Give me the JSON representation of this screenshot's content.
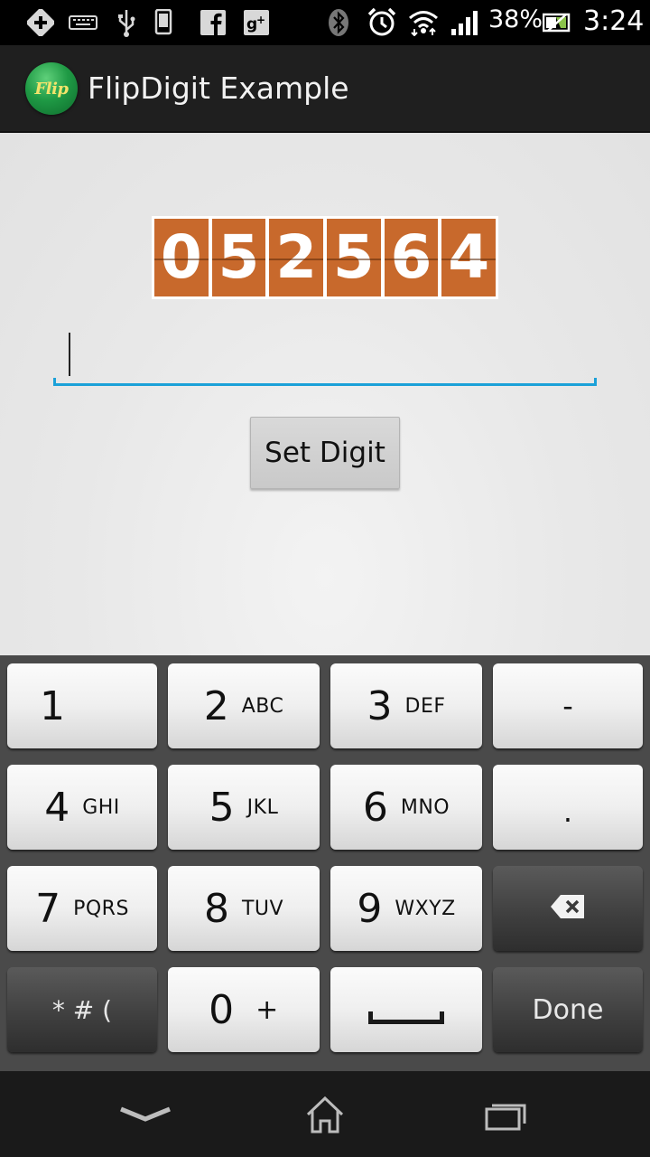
{
  "status_bar": {
    "battery_percent": "38%",
    "time": "3:24",
    "icons": [
      "add-icon",
      "keyboard-icon",
      "usb-icon",
      "phone-icon",
      "facebook-icon",
      "google-plus-icon",
      "bluetooth-icon",
      "alarm-icon",
      "wifi-icon",
      "signal-icon",
      "battery-icon"
    ]
  },
  "action_bar": {
    "logo_text": "Flip",
    "title": "FlipDigit Example"
  },
  "flip_display": {
    "digits": [
      "0",
      "5",
      "2",
      "5",
      "6",
      "4"
    ],
    "color": "#c8692c"
  },
  "input": {
    "value": "",
    "accent_color": "#1ba1d8"
  },
  "set_button": {
    "label": "Set Digit"
  },
  "keyboard": {
    "keys": [
      {
        "num": "1",
        "letters": ""
      },
      {
        "num": "2",
        "letters": "ABC"
      },
      {
        "num": "3",
        "letters": "DEF"
      },
      {
        "num": "-",
        "letters": ""
      },
      {
        "num": "4",
        "letters": "GHI"
      },
      {
        "num": "5",
        "letters": "JKL"
      },
      {
        "num": "6",
        "letters": "MNO"
      },
      {
        "num": ".",
        "letters": ""
      },
      {
        "num": "7",
        "letters": "PQRS"
      },
      {
        "num": "8",
        "letters": "TUV"
      },
      {
        "num": "9",
        "letters": "WXYZ"
      },
      {
        "num": "",
        "letters": ""
      },
      {
        "num": "* # (",
        "letters": ""
      },
      {
        "num": "0",
        "letters": "+"
      },
      {
        "num": "",
        "letters": ""
      },
      {
        "num": "Done",
        "letters": ""
      }
    ],
    "backspace_icon": "backspace-icon",
    "space_icon": "space-icon"
  },
  "nav_bar": {
    "icons": [
      "back-icon",
      "home-icon",
      "recent-apps-icon"
    ]
  }
}
